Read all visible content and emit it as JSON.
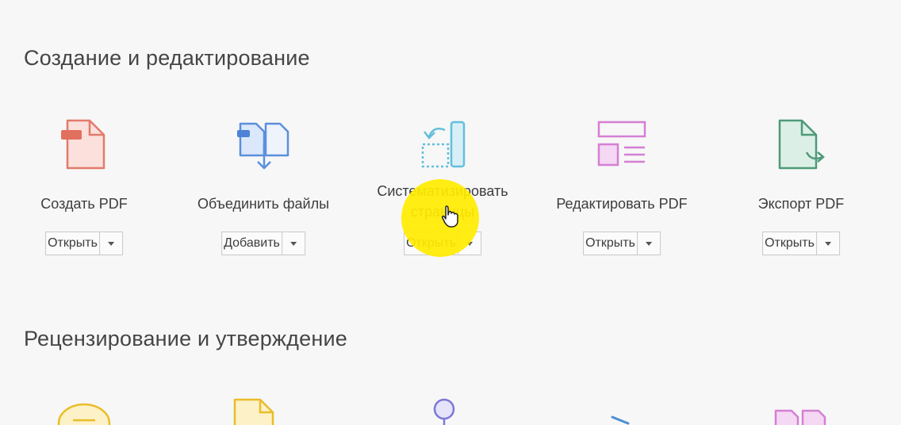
{
  "sections": [
    {
      "title": "Создание и редактирование"
    },
    {
      "title": "Рецензирование и утверждение"
    }
  ],
  "tools": [
    {
      "label": "Создать PDF",
      "button": "Открыть",
      "icon": "create-pdf-icon",
      "color": "#e27a6b"
    },
    {
      "label": "Объединить файлы",
      "button": "Добавить",
      "icon": "combine-files-icon",
      "color": "#5b8fdc"
    },
    {
      "label": "Систематизировать страницы",
      "button": "Открыть",
      "icon": "organize-pages-icon",
      "color": "#63bfdc"
    },
    {
      "label": "Редактировать PDF",
      "button": "Открыть",
      "icon": "edit-pdf-icon",
      "color": "#d57fd4"
    },
    {
      "label": "Экспорт PDF",
      "button": "Открыть",
      "icon": "export-pdf-icon",
      "color": "#4e9a79"
    }
  ],
  "highlight": {
    "color": "#ffec00"
  }
}
